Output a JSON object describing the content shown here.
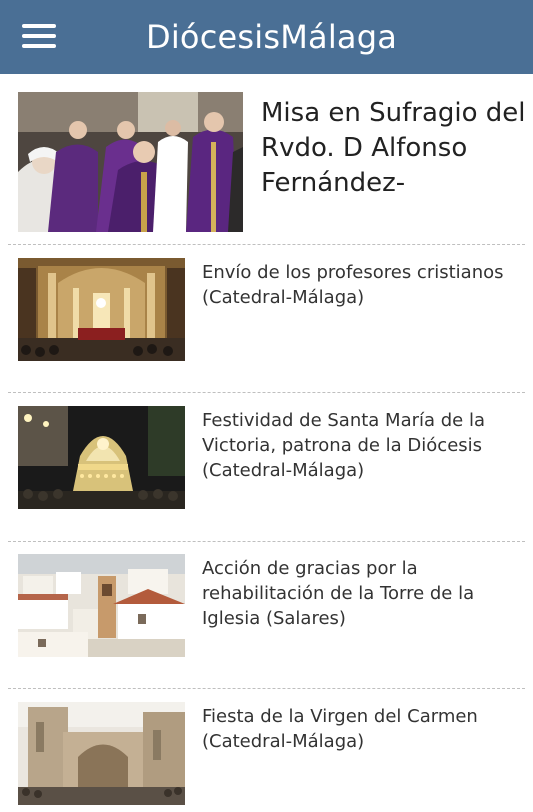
{
  "header": {
    "title": "DiócesisMálaga",
    "menu_icon": "hamburger-menu-icon"
  },
  "featured": {
    "title": "Misa en Sufragio del Rvdo. D Alfonso Fernández-"
  },
  "news": [
    {
      "title": "Envío de los profesores cristianos (Catedral-Málaga)"
    },
    {
      "title": "Festividad de Santa María de la Victoria, patrona de la Diócesis (Catedral-Málaga)"
    },
    {
      "title": "Acción de gracias por la rehabilitación de la Torre de la Iglesia (Salares)"
    },
    {
      "title": "Fiesta de la Virgen del Carmen (Catedral-Málaga)"
    }
  ],
  "colors": {
    "appbar": "#4a6f95",
    "divider": "#bfbfbf"
  }
}
